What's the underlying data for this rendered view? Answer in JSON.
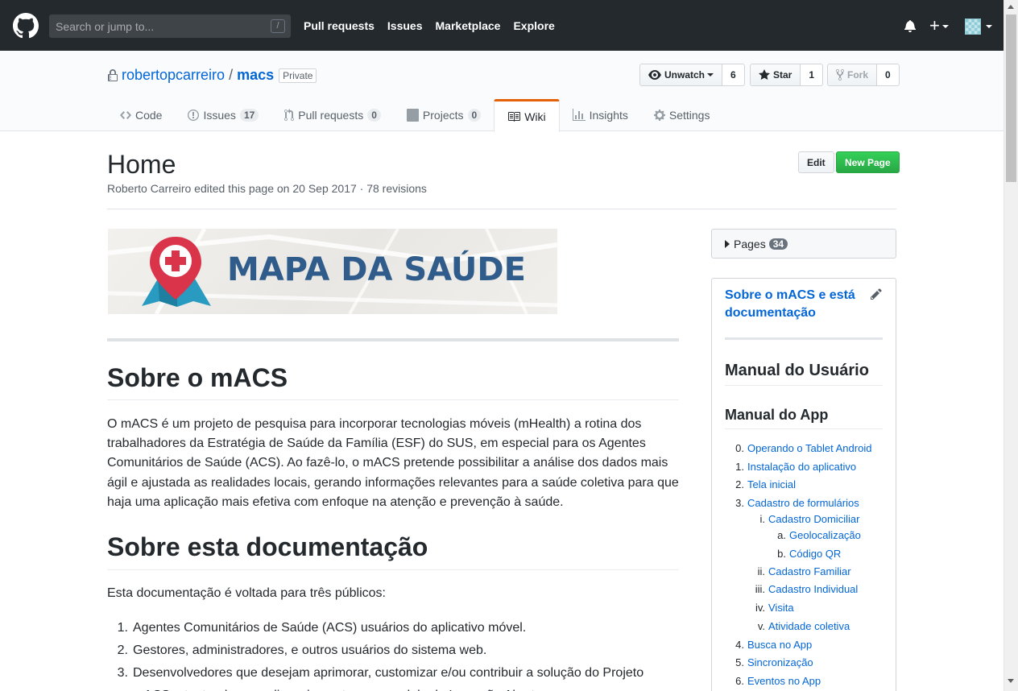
{
  "header": {
    "search_placeholder": "Search or jump to...",
    "search_key": "/",
    "nav": [
      "Pull requests",
      "Issues",
      "Marketplace",
      "Explore"
    ],
    "plus_label": "+"
  },
  "repo": {
    "owner": "robertopcarreiro",
    "separator": "/",
    "name": "macs",
    "visibility": "Private",
    "watch_label": "Unwatch",
    "watch_count": "6",
    "star_label": "Star",
    "star_count": "1",
    "fork_label": "Fork",
    "fork_count": "0"
  },
  "tabs": [
    {
      "label": "Code",
      "icon": "code-icon",
      "count": null
    },
    {
      "label": "Issues",
      "icon": "issue-icon",
      "count": "17"
    },
    {
      "label": "Pull requests",
      "icon": "pull-request-icon",
      "count": "0"
    },
    {
      "label": "Projects",
      "icon": "project-icon",
      "count": "0"
    },
    {
      "label": "Wiki",
      "icon": "book-icon",
      "count": null,
      "selected": true
    },
    {
      "label": "Insights",
      "icon": "graph-icon",
      "count": null
    },
    {
      "label": "Settings",
      "icon": "gear-icon",
      "count": null
    }
  ],
  "wiki": {
    "title": "Home",
    "meta": "Roberto Carreiro edited this page on 20 Sep 2017 · 78 revisions",
    "edit_label": "Edit",
    "new_page_label": "New Page",
    "banner_text": "MAPA DA SAÚDE",
    "h1_about": "Sobre o mACS",
    "about_text": "O mACS é um projeto de pesquisa para incorporar tecnologias móveis (mHealth) a rotina dos trabalhadores da Estratégia de Saúde da Família (ESF) do SUS, em especial para os Agentes Comunitários de Saúde (ACS). Ao fazê-lo, o mACS pretende possibilitar a análise dos dados mais ágil e ajustada as realidades locais, gerando informações relevantes para a saúde coletiva para que haja uma aplicação mais efetiva com enfoque na atenção e prevenção à saúde.",
    "h1_doc": "Sobre esta documentação",
    "doc_intro": "Esta documentação é voltada para três públicos:",
    "audiences": [
      {
        "n": "1.",
        "text": "Agentes Comunitários de Saúde (ACS) usuários do aplicativo móvel."
      },
      {
        "n": "2.",
        "text": "Gestores, administradores, e outros usuários do sistema web."
      },
      {
        "n": "3.",
        "text": "Desenvolvedores que desejam aprimorar, customizar e/ou contribuir a solução do Projeto"
      },
      {
        "n": "",
        "text": "mACS, atentando-se ao licenciamento e ao modelo de Inovação Aberta."
      }
    ]
  },
  "sidebar": {
    "pages_label": "Pages",
    "pages_count": "34",
    "title_link": "Sobre o mACS e está documentação",
    "h_manual_usuario": "Manual do Usuário",
    "h_manual_app": "Manual do App",
    "toc": [
      {
        "n": "0.",
        "text": "Operando o Tablet Android",
        "level": 0
      },
      {
        "n": "1.",
        "text": "Instalação do aplicativo",
        "level": 0
      },
      {
        "n": "2.",
        "text": "Tela inicial",
        "level": 0
      },
      {
        "n": "3.",
        "text": "Cadastro de formulários",
        "level": 0
      },
      {
        "n": "i.",
        "text": "Cadastro Domiciliar",
        "level": 1
      },
      {
        "n": "a.",
        "text": "Geolocalização",
        "level": 2
      },
      {
        "n": "b.",
        "text": "Código QR",
        "level": 2
      },
      {
        "n": "ii.",
        "text": "Cadastro Familiar",
        "level": 1
      },
      {
        "n": "iii.",
        "text": "Cadastro Individual",
        "level": 1
      },
      {
        "n": "iv.",
        "text": "Visita",
        "level": 1
      },
      {
        "n": "v.",
        "text": "Atividade coletiva",
        "level": 1
      },
      {
        "n": "4.",
        "text": "Busca no App",
        "level": 0
      },
      {
        "n": "5.",
        "text": "Sincronização",
        "level": 0
      },
      {
        "n": "6.",
        "text": "Eventos no App",
        "level": 0
      }
    ]
  },
  "colors": {
    "header_bg": "#24292e",
    "link": "#0366d6",
    "wiki_tab_accent": "#e36209",
    "new_page_green": "#28a745",
    "banner_text": "#2f5c8a",
    "pin_red": "#d9344a",
    "map_teal": "#2a9bc0"
  }
}
